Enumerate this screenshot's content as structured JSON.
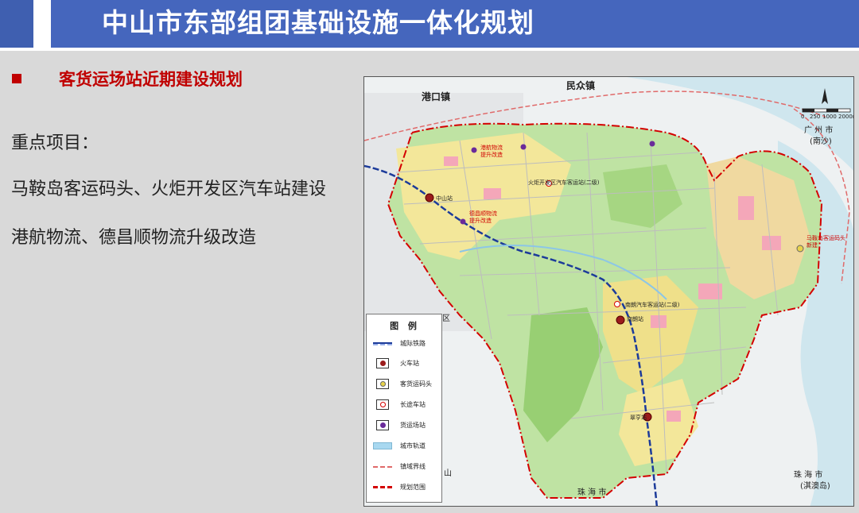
{
  "header": {
    "title": "中山市东部组团基础设施一体化规划",
    "color": "#4566bd"
  },
  "section": {
    "subtitle": "客货运场站近期建设规划",
    "accent_color": "#c00000"
  },
  "content": {
    "key_projects_label": "重点项目：",
    "line1": "马鞍岛客运码头、火炬开发区汽车站建设",
    "line2": "港航物流、德昌顺物流升级改造"
  },
  "map": {
    "places": {
      "gangkou": "港口镇",
      "minzhong": "民众镇",
      "guangzhou": "广 州 市",
      "nansha": "(南沙)",
      "zhuhai_bottom": "珠 海 市",
      "zhuhai_right": "珠 海 市",
      "qiao": "(淇澳岛)",
      "district_fragment": "区",
      "shan": "山"
    },
    "annotations": {
      "gangha_wuliu": "港航物流",
      "gangha_wuliu2": "提升改造",
      "dechang": "德昌顺物流",
      "dechang2": "提升改造",
      "zhongshan_station": "中山站",
      "torch_bus": "火炬开发区汽车客运站(二级)",
      "nanlang_bus": "南朗汽车客运站(二级)",
      "nanlang_station": "南朗站",
      "cuiheng_station": "翠亨站",
      "maan_pier": "马鞍岛客运码头",
      "maan_pier2": "新建"
    },
    "scale": {
      "ticks": [
        "250",
        "1000",
        "2000m"
      ],
      "zero": "0"
    },
    "legend": {
      "title": "图 例",
      "items": [
        {
          "label": "城际铁路",
          "symbol": "intercity-rail"
        },
        {
          "label": "火车站",
          "symbol": "train-station"
        },
        {
          "label": "客货运码头",
          "symbol": "pier"
        },
        {
          "label": "长途车站",
          "symbol": "coach-station"
        },
        {
          "label": "货运场站",
          "symbol": "freight-station"
        },
        {
          "label": "城市轨道",
          "symbol": "urban-rail"
        },
        {
          "label": "镇域界线",
          "symbol": "town-boundary"
        },
        {
          "label": "规划范围",
          "symbol": "planning-boundary"
        }
      ]
    }
  }
}
